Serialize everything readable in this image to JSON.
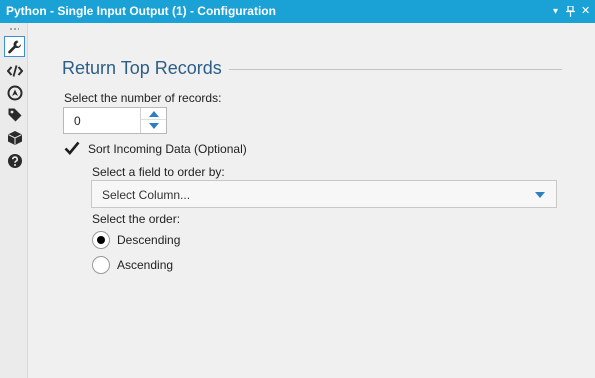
{
  "window": {
    "title": "Python - Single Input Output (1) - Configuration",
    "controls": {
      "dropdown": "▾",
      "pin": "✚",
      "close": "✕"
    }
  },
  "toolbar": {
    "items": [
      {
        "icon": "wrench-icon",
        "active": true
      },
      {
        "icon": "code-tags-icon",
        "active": false
      },
      {
        "icon": "compass-icon",
        "active": false
      },
      {
        "icon": "tag-icon",
        "active": false
      },
      {
        "icon": "box-icon",
        "active": false
      },
      {
        "icon": "help-icon",
        "active": false
      }
    ]
  },
  "config": {
    "heading": "Return Top Records",
    "num_records_label": "Select the number of records:",
    "num_records_value": "0",
    "sort_checkbox_label": "Sort Incoming Data (Optional)",
    "sort_checked": true,
    "field_label": "Select a field to order by:",
    "field_placeholder": "Select Column...",
    "order_label": "Select the order:",
    "order_options": [
      {
        "label": "Descending",
        "selected": true
      },
      {
        "label": "Ascending",
        "selected": false
      }
    ]
  },
  "colors": {
    "titlebar": "#1aa1d6",
    "heading": "#2c5e88",
    "accent": "#2d7fc1"
  }
}
